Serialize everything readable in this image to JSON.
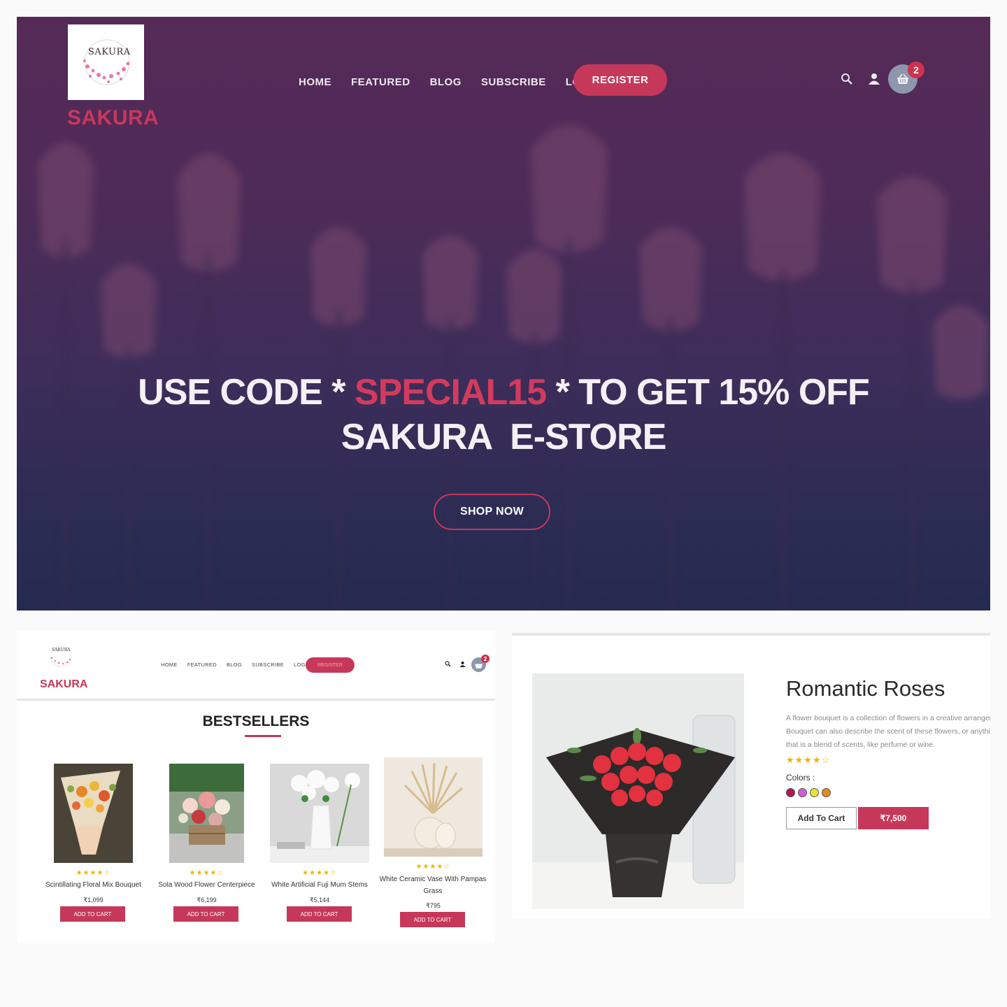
{
  "hero": {
    "logo_text": "SAKURA",
    "brand": "SAKURA",
    "nav": [
      "HOME",
      "FEATURED",
      "BLOG",
      "SUBSCRIBE",
      "LOGIN"
    ],
    "register_label": "REGISTER",
    "cart_count": "2",
    "headline_prefix": "USE CODE * ",
    "promo_code": "SPECIAL15",
    "headline_suffix": " * TO GET 15% OFF",
    "headline_line2": "SAKURA  E-STORE",
    "shop_now_label": "SHOP NOW",
    "icons": [
      "search-icon",
      "user-icon",
      "basket-icon"
    ]
  },
  "bestsellers": {
    "logo_text": "SAKURA",
    "brand": "SAKURA",
    "nav": [
      "HOME",
      "FEATURED",
      "BLOG",
      "SUBSCRIBE",
      "LOGIN"
    ],
    "register_label": "REGISTER",
    "cart_count": "2",
    "title": "BESTSELLERS",
    "products": [
      {
        "name": "Scintillating Floral Mix Bouquet",
        "price": "₹1,099",
        "rating": "★★★★☆",
        "button": "ADD TO CART"
      },
      {
        "name": "Sola Wood Flower Centerpiece",
        "price": "₹6,199",
        "rating": "★★★★☆",
        "button": "ADD TO CART"
      },
      {
        "name": "White Artificial Fuji Mum Stems",
        "price": "₹5,144",
        "rating": "★★★★☆",
        "button": "ADD TO CART"
      },
      {
        "name_line1": "White Ceramic Vase With Pampas",
        "name_line2": "Grass",
        "price": "₹795",
        "rating": "★★★★☆",
        "button": "ADD TO CART"
      }
    ]
  },
  "product_detail": {
    "title": "Romantic Roses",
    "description_lines": [
      "A flower bouquet is a collection of flowers in a creative arrangem",
      "Bouquet can also describe the scent of these flowers, or anythin",
      "that is a blend of scents, like perfume or wine."
    ],
    "rating": "★★★★☆",
    "colors_label": "Colors :",
    "colors": [
      "#b4174f",
      "#d65ad8",
      "#e8e23a",
      "#e08a1e"
    ],
    "add_to_cart_label": "Add To Cart",
    "price": "₹7,500"
  },
  "theme": {
    "accent": "#c6385a",
    "hero_bg": "#4e2b58",
    "star": "#f0b400"
  }
}
